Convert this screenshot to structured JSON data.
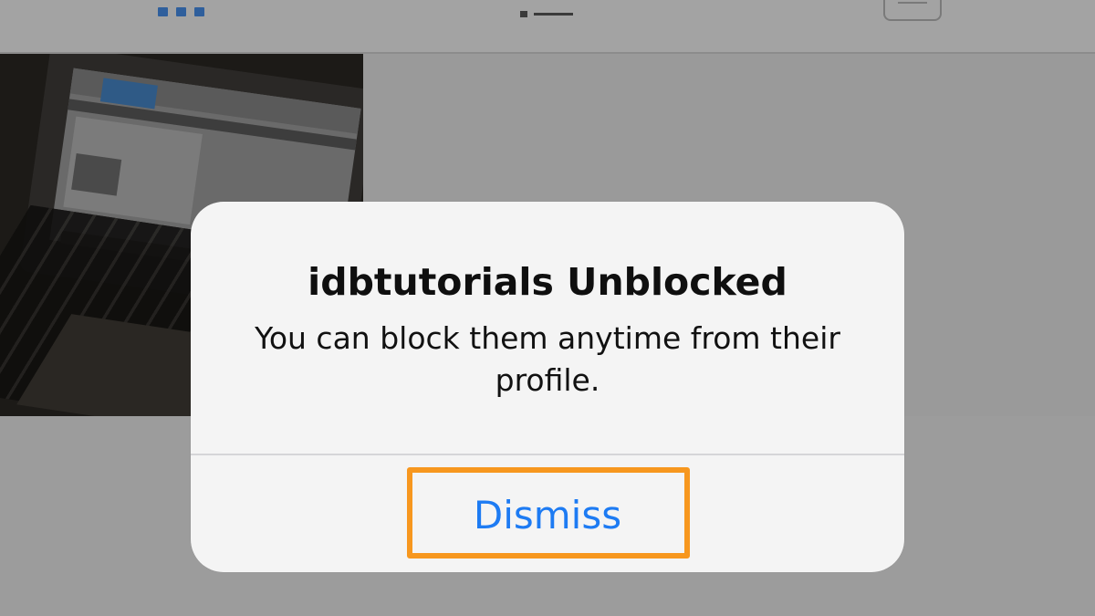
{
  "alert": {
    "title": "idbtutorials Unblocked",
    "message": "You can block them anytime from their profile.",
    "dismiss_label": "Dismiss"
  },
  "icons": {
    "grid": "grid-view-icon",
    "list": "list-view-icon",
    "tagged": "tagged-photos-icon"
  },
  "colors": {
    "dismiss_text": "#1d7bf3",
    "highlight": "#f7971e",
    "alert_background": "#f4f4f4",
    "overlay": "#9a9a9a"
  }
}
